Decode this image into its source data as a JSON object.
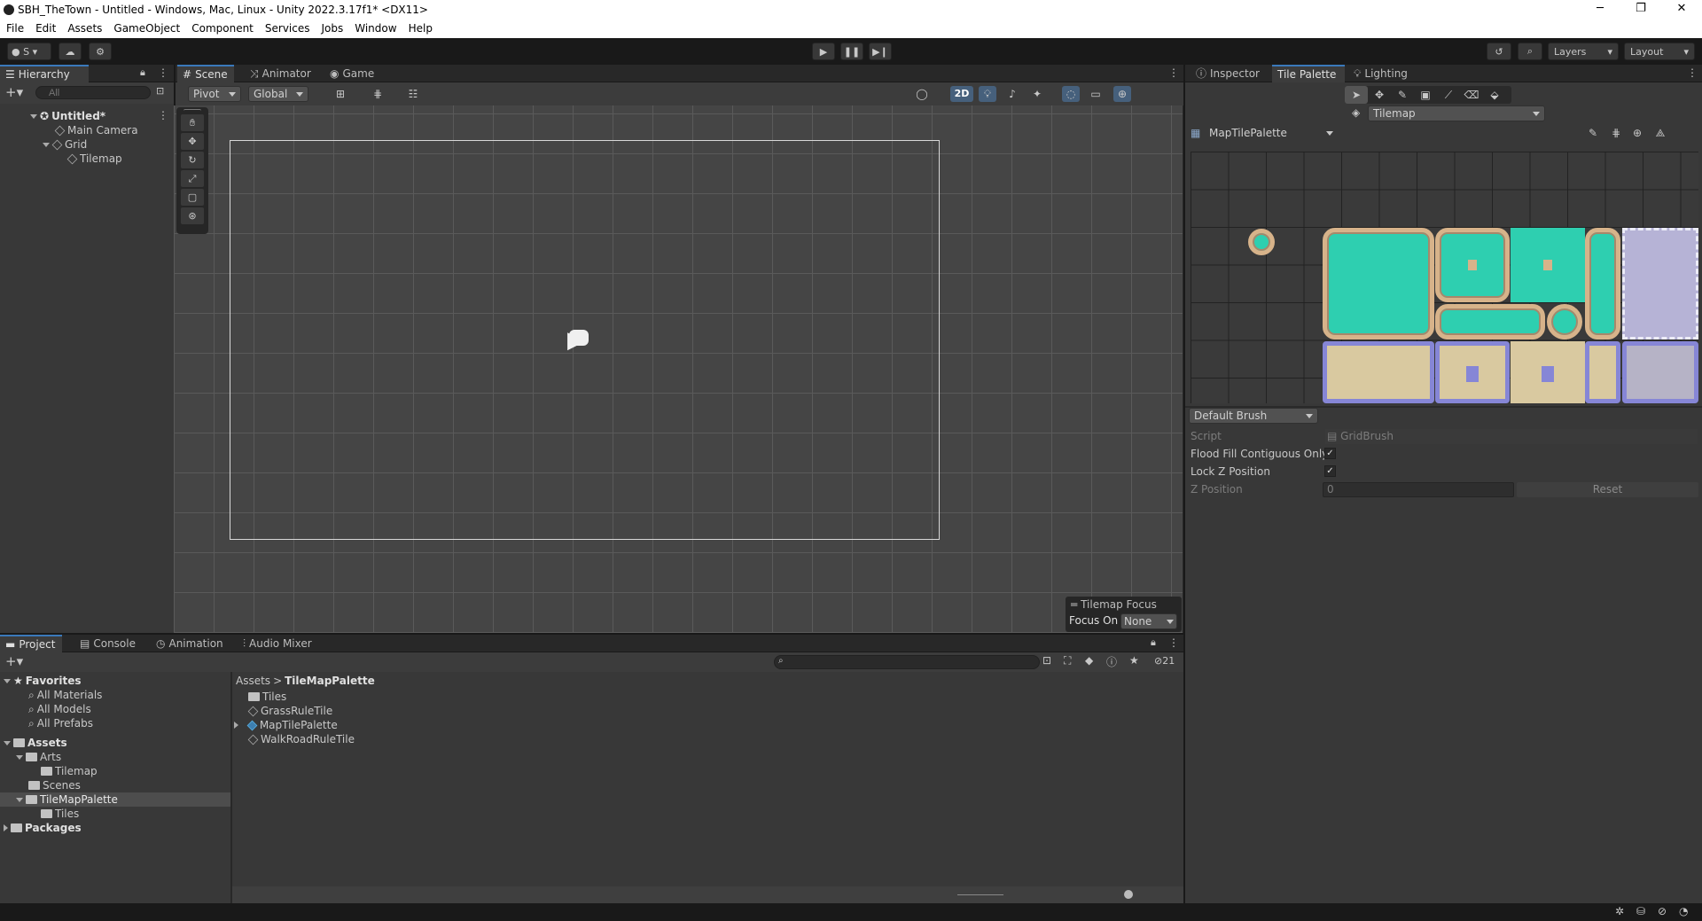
{
  "window": {
    "title": "SBH_TheTown - Untitled - Windows, Mac, Linux - Unity 2022.3.17f1* <DX11>",
    "minimize": "─",
    "maximize": "❐",
    "close": "✕"
  },
  "menu": [
    "File",
    "Edit",
    "Assets",
    "GameObject",
    "Component",
    "Services",
    "Jobs",
    "Window",
    "Help"
  ],
  "toolbar": {
    "account": "S",
    "layers": "Layers",
    "layout": "Layout"
  },
  "hierarchy": {
    "tab": "Hierarchy",
    "search_placeholder": "All",
    "scene": "Untitled*",
    "items": [
      "Main Camera",
      "Grid",
      "Tilemap"
    ]
  },
  "scene_tabs": [
    "Scene",
    "Animator",
    "Game"
  ],
  "scene_toolbar": {
    "pivot": "Pivot",
    "global": "Global",
    "mode_2d": "2D"
  },
  "tilemap_focus": {
    "title": "Tilemap Focus",
    "label": "Focus On",
    "value": "None"
  },
  "right_tabs": [
    "Inspector",
    "Tile Palette",
    "Lighting"
  ],
  "tile_palette": {
    "target": "Tilemap",
    "palette": "MapTilePalette",
    "brush": "Default Brush"
  },
  "brush_props": {
    "script_label": "Script",
    "script_value": "GridBrush",
    "flood_label": "Flood Fill Contiguous Only",
    "lockz_label": "Lock Z Position",
    "zpos_label": "Z Position",
    "zpos_value": "0",
    "reset": "Reset"
  },
  "bottom_tabs": [
    "Project",
    "Console",
    "Animation",
    "Audio Mixer"
  ],
  "project": {
    "favorites": "Favorites",
    "fav_items": [
      "All Materials",
      "All Models",
      "All Prefabs"
    ],
    "assets": "Assets",
    "tree": [
      "Arts",
      "Tilemap",
      "Scenes",
      "TileMapPalette",
      "Tiles"
    ],
    "packages": "Packages",
    "breadcrumb_root": "Assets",
    "breadcrumb_sep": ">",
    "breadcrumb_current": "TileMapPalette",
    "files": [
      "Tiles",
      "GrassRuleTile",
      "MapTilePalette",
      "WalkRoadRuleTile"
    ],
    "hidden_count": "21"
  }
}
